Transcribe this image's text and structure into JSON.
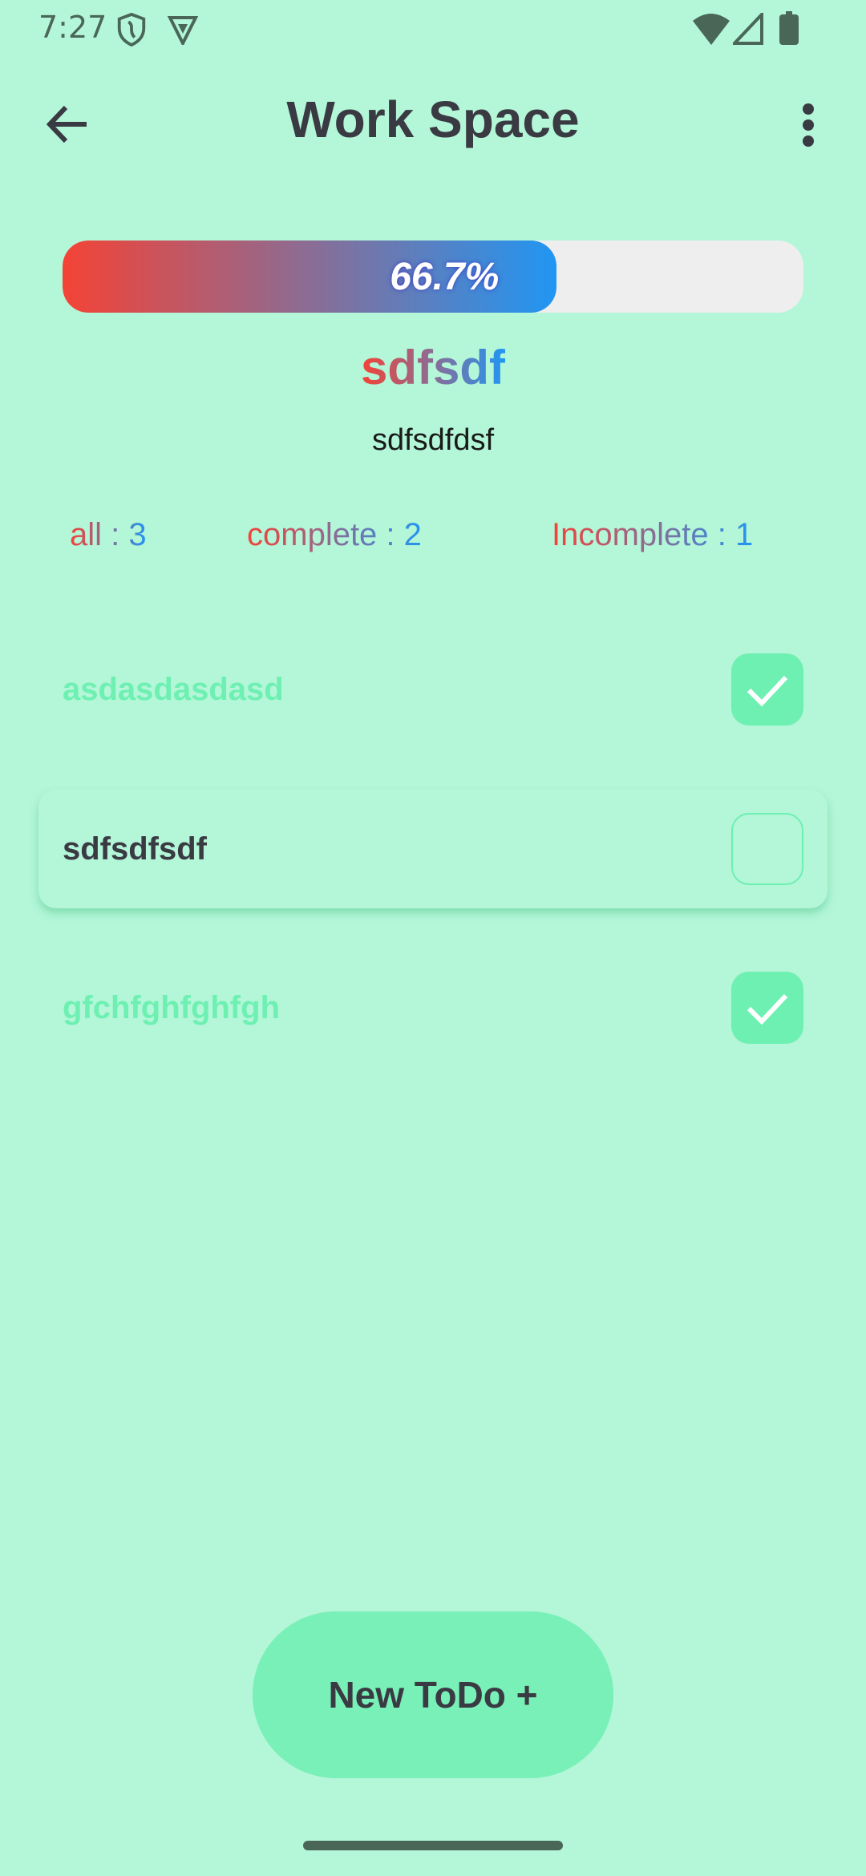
{
  "status_bar": {
    "time": "7:27",
    "icons": [
      "shield-icon",
      "vpn-icon",
      "wifi-icon",
      "signal-icon",
      "battery-icon"
    ]
  },
  "header": {
    "title": "Work Space",
    "back_icon": "arrow-left-icon",
    "menu_icon": "more-vert-icon"
  },
  "progress": {
    "value": 66.7,
    "label": "66.7%"
  },
  "workspace": {
    "name": "sdfsdf",
    "description": "sdfsdfdsf"
  },
  "stats": {
    "all": "all : 3",
    "complete": "complete : 2",
    "incomplete": "Incomplete : 1"
  },
  "todos": [
    {
      "label": "asdasdasdasd",
      "done": true
    },
    {
      "label": "sdfsdfsdf",
      "done": false
    },
    {
      "label": "gfchfghfghfgh",
      "done": true
    }
  ],
  "new_button": "New ToDo +",
  "colors": {
    "background": "#b3f6d8",
    "accent": "#6ef0b2",
    "gradient_start": "#f44336",
    "gradient_end": "#2196f3"
  }
}
